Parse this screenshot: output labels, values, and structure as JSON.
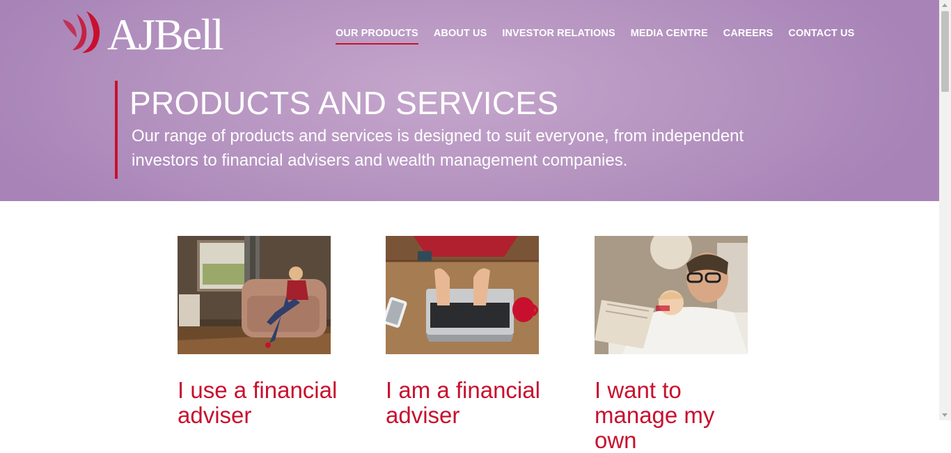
{
  "brand": {
    "logo_text": "AJBell",
    "accent": "#c8102e",
    "hero_bg": "#b594c0"
  },
  "nav": {
    "items": [
      {
        "label": "OUR PRODUCTS",
        "active": true
      },
      {
        "label": "ABOUT US"
      },
      {
        "label": "INVESTOR RELATIONS"
      },
      {
        "label": "MEDIA CENTRE"
      },
      {
        "label": "CAREERS"
      },
      {
        "label": "CONTACT US"
      }
    ]
  },
  "hero": {
    "title": "PRODUCTS AND SERVICES",
    "subtitle": "Our range of products and services is designed to suit everyone, from independent investors to financial advisers and wealth management companies."
  },
  "cards": [
    {
      "title": "I use a financial adviser"
    },
    {
      "title": "I am a financial adviser"
    },
    {
      "title": "I want to manage my own"
    }
  ]
}
